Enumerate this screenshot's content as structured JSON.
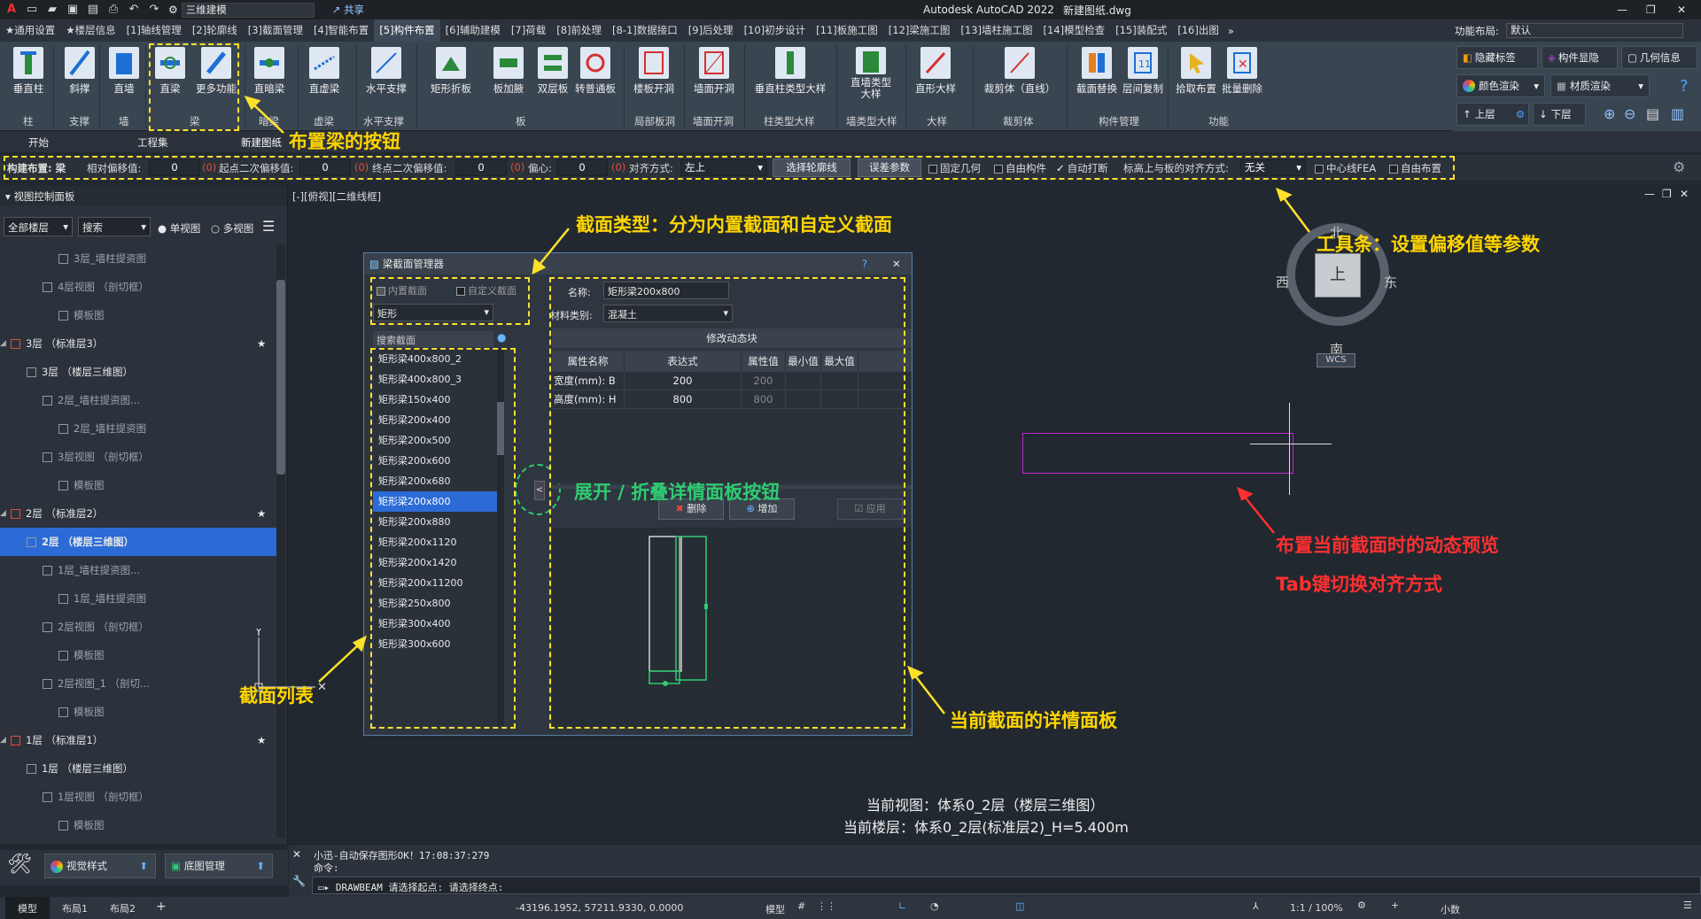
{
  "title_bar": {
    "workspace": "三维建模",
    "share": "共享",
    "app": "Autodesk AutoCAD 2022",
    "file": "新建图纸.dwg"
  },
  "menu_tabs": [
    "★通用设置",
    "★楼层信息",
    "[1]轴线管理",
    "[2]轮廓线",
    "[3]截面管理",
    "[4]智能布置",
    "[5]构件布置",
    "[6]辅助建模",
    "[7]荷载",
    "[8]前处理",
    "[8-1]数据接口",
    "[9]后处理",
    "[10]初步设计",
    "[11]板施工图",
    "[12]梁施工图",
    "[13]墙柱施工图",
    "[14]模型检查",
    "[15]装配式",
    "[16]出图"
  ],
  "function_layout": {
    "label": "功能布局:",
    "value": "默认"
  },
  "ribbon": {
    "buttons": [
      "垂直柱",
      "斜撑",
      "直墙",
      "直梁",
      "更多功能",
      "直暗梁",
      "直虚梁",
      "水平支撑",
      "矩形折板",
      "板加腋",
      "双层板",
      "转普通板",
      "楼板开洞",
      "墙面开洞",
      "垂直柱类型大样",
      "直墙类型大样",
      "直形大样",
      "裁剪体（直线）",
      "截面替换",
      "层间复制",
      "拾取布置",
      "批量删除"
    ],
    "groups": [
      "柱",
      "支撑",
      "墙",
      "梁",
      "暗梁",
      "虚梁",
      "水平支撑",
      "板",
      "局部板洞",
      "墙面开洞",
      "柱类型大样",
      "墙类型大样",
      "大样",
      "裁剪体",
      "构件管理",
      "功能"
    ],
    "right": [
      "隐藏标签",
      "构件显隐",
      "几何信息",
      "颜色渲染",
      "材质渲染",
      "上层",
      "下层"
    ]
  },
  "sub_tabs": [
    "开始",
    "工程集",
    "新建图纸"
  ],
  "toolbar": {
    "label_build": "构建布置: 梁",
    "rel_offset": "相对偏移值:",
    "rel_offset_val": "0",
    "start_offset": "起点二次偏移值:",
    "start_offset_val": "0",
    "end_offset": "终点二次偏移值:",
    "end_offset_val": "0",
    "ecc": "偏心:",
    "ecc_val": "0",
    "align_label": "对齐方式:",
    "align_val": "左上",
    "select_outline": "选择轮廓线",
    "error_param": "误差参数",
    "fixed_geom": "固定几何",
    "free_comp": "自由构件",
    "auto_break": "自动打断",
    "elev_align": "标高上与板的对齐方式:",
    "elev_align_val": "无关",
    "centerline": "中心线FEA",
    "free_place": "自由布置",
    "marker": "(0)"
  },
  "left_panel": {
    "title": "视图控制面板",
    "floor_select": "全部楼层",
    "search": "搜索",
    "single": "单视图",
    "multi": "多视图",
    "tree": [
      {
        "text": "3层_墙柱提资图",
        "depth": 3
      },
      {
        "text": "4层视图 （剖切框）",
        "depth": 2
      },
      {
        "text": "模板图",
        "depth": 3
      },
      {
        "text": "3层 （标准层3）",
        "depth": 0
      },
      {
        "text": "3层 （楼层三维图）",
        "depth": 1
      },
      {
        "text": "2层_墙柱提资图...",
        "depth": 2
      },
      {
        "text": "2层_墙柱提资图",
        "depth": 3
      },
      {
        "text": "3层视图 （剖切框）",
        "depth": 2
      },
      {
        "text": "模板图",
        "depth": 3
      },
      {
        "text": "2层 （标准层2）",
        "depth": 0
      },
      {
        "text": "2层 （楼层三维图）",
        "depth": 1
      },
      {
        "text": "1层_墙柱提资图...",
        "depth": 2
      },
      {
        "text": "1层_墙柱提资图",
        "depth": 3
      },
      {
        "text": "2层视图 （剖切框）",
        "depth": 2
      },
      {
        "text": "模板图",
        "depth": 3
      },
      {
        "text": "2层视图_1 （剖切...",
        "depth": 2
      },
      {
        "text": "模板图",
        "depth": 3
      },
      {
        "text": "1层 （标准层1）",
        "depth": 0
      },
      {
        "text": "1层 （楼层三维图）",
        "depth": 1
      },
      {
        "text": "1层视图 （剖切框）",
        "depth": 2
      },
      {
        "text": "模板图",
        "depth": 3
      }
    ],
    "bottom_btn1": "视觉样式",
    "bottom_btn2": "底图管理"
  },
  "view_label": "[-][俯视][二维线框]",
  "dialog": {
    "title": "梁截面管理器",
    "builtin": "内置截面",
    "custom": "自定义截面",
    "shape": "矩形",
    "search": "搜索截面",
    "sections": [
      "矩形梁400x800_2",
      "矩形梁400x800_3",
      "矩形梁150x400",
      "矩形梁200x400",
      "矩形梁200x500",
      "矩形梁200x600",
      "矩形梁200x680",
      "矩形梁200x800",
      "矩形梁200x880",
      "矩形梁200x1120",
      "矩形梁200x1420",
      "矩形梁200x11200",
      "矩形梁250x800",
      "矩形梁300x400",
      "矩形梁300x600"
    ],
    "name_label": "名称:",
    "name_value": "矩形梁200x800",
    "material_label": "材料类别:",
    "material_value": "混凝土",
    "modify_block": "修改动态块",
    "table_headers": [
      "属性名称",
      "表达式",
      "属性值",
      "最小值",
      "最大值"
    ],
    "rows": [
      {
        "name": "宽度(mm): B",
        "expr": "200",
        "val": "200"
      },
      {
        "name": "高度(mm): H",
        "expr": "800",
        "val": "800"
      }
    ],
    "delete": "删除",
    "add": "增加",
    "apply": "应用"
  },
  "annotations": {
    "place_beam": "布置梁的按钮",
    "section_type": "截面类型：分为内置截面和自定义截面",
    "toolbar_tip": "工具条：设置偏移值等参数",
    "expand_collapse": "展开 / 折叠详情面板按钮",
    "section_list": "截面列表",
    "detail_panel": "当前截面的详情面板",
    "preview": "布置当前截面时的动态预览",
    "tab_switch": "Tab键切换对齐方式"
  },
  "viewcube": {
    "n": "北",
    "s": "南",
    "e": "东",
    "w": "西",
    "top": "上",
    "wcs": "WCS"
  },
  "canvas_info": {
    "view": "当前视图：体系0_2层（楼层三维图）",
    "floor": "当前楼层：体系0_2层(标准层2)_H=5.400m"
  },
  "command": {
    "line1": "小迅-自动保存图形OK！17:08:37:279",
    "line2": "命令:",
    "input": "DRAWBEAM 请选择起点:  请选择终点:"
  },
  "status": {
    "tabs": [
      "模型",
      "布局1",
      "布局2"
    ],
    "coords": "-43196.1952, 57211.9330, 0.0000",
    "model": "模型",
    "scale": "1:1 / 100%",
    "units": "小数"
  },
  "colors": {
    "accent": "#ffd500",
    "preview": "#c026d3",
    "green": "#2ecc71",
    "red": "#ff3030"
  }
}
